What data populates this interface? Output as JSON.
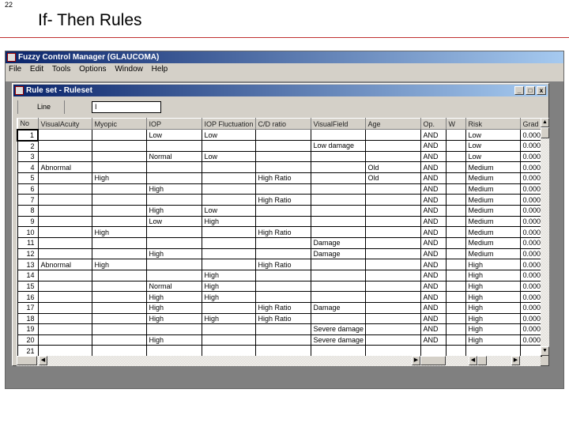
{
  "slide": {
    "number": "22",
    "title": "If- Then Rules"
  },
  "app": {
    "title": "Fuzzy Control Manager (GLAUCOMA)",
    "menu": [
      "File",
      "Edit",
      "Tools",
      "Options",
      "Window",
      "Help"
    ]
  },
  "child": {
    "title": "Rule set - Ruleset",
    "line_label": "Line",
    "line_value": "I",
    "buttons": {
      "minimize": "_",
      "maximize": "□",
      "close": "x"
    }
  },
  "grid": {
    "columns": [
      "No",
      "VisualAcuity",
      "Myopic",
      "IOP",
      "IOP Fluctuation",
      "C/D ratio",
      "VisualField",
      "Age",
      "Op.",
      "W",
      "Risk",
      "Grad"
    ],
    "rows": [
      [
        "1",
        "",
        "",
        "Low",
        "Low",
        "",
        "",
        "",
        "AND",
        "",
        "Low",
        "0.000"
      ],
      [
        "2",
        "",
        "",
        "",
        "",
        "",
        "Low damage",
        "",
        "AND",
        "",
        "Low",
        "0.000"
      ],
      [
        "3",
        "",
        "",
        "Normal",
        "Low",
        "",
        "",
        "",
        "AND",
        "",
        "Low",
        "0.000"
      ],
      [
        "4",
        "Abnormal",
        "",
        "",
        "",
        "",
        "",
        "Old",
        "AND",
        "",
        "Medium",
        "0.000"
      ],
      [
        "5",
        "",
        "High",
        "",
        "",
        "High Ratio",
        "",
        "Old",
        "AND",
        "",
        "Medium",
        "0.000"
      ],
      [
        "6",
        "",
        "",
        "High",
        "",
        "",
        "",
        "",
        "AND",
        "",
        "Medium",
        "0.000"
      ],
      [
        "7",
        "",
        "",
        "",
        "",
        "High Ratio",
        "",
        "",
        "AND",
        "",
        "Medium",
        "0.000"
      ],
      [
        "8",
        "",
        "",
        "High",
        "Low",
        "",
        "",
        "",
        "AND",
        "",
        "Medium",
        "0.000"
      ],
      [
        "9",
        "",
        "",
        "Low",
        "High",
        "",
        "",
        "",
        "AND",
        "",
        "Medium",
        "0.000"
      ],
      [
        "10",
        "",
        "High",
        "",
        "",
        "High Ratio",
        "",
        "",
        "AND",
        "",
        "Medium",
        "0.000"
      ],
      [
        "11",
        "",
        "",
        "",
        "",
        "",
        "Damage",
        "",
        "AND",
        "",
        "Medium",
        "0.000"
      ],
      [
        "12",
        "",
        "",
        "High",
        "",
        "",
        "Damage",
        "",
        "AND",
        "",
        "Medium",
        "0.000"
      ],
      [
        "13",
        "Abnormal",
        "High",
        "",
        "",
        "High Ratio",
        "",
        "",
        "AND",
        "",
        "High",
        "0.000"
      ],
      [
        "14",
        "",
        "",
        "",
        "High",
        "",
        "",
        "",
        "AND",
        "",
        "High",
        "0.000"
      ],
      [
        "15",
        "",
        "",
        "Normal",
        "High",
        "",
        "",
        "",
        "AND",
        "",
        "High",
        "0.000"
      ],
      [
        "16",
        "",
        "",
        "High",
        "High",
        "",
        "",
        "",
        "AND",
        "",
        "High",
        "0.000"
      ],
      [
        "17",
        "",
        "",
        "High",
        "",
        "High Ratio",
        "Damage",
        "",
        "AND",
        "",
        "High",
        "0.000"
      ],
      [
        "18",
        "",
        "",
        "High",
        "High",
        "High Ratio",
        "",
        "",
        "AND",
        "",
        "High",
        "0.000"
      ],
      [
        "19",
        "",
        "",
        "",
        "",
        "",
        "Severe damage",
        "",
        "AND",
        "",
        "High",
        "0.000"
      ],
      [
        "20",
        "",
        "",
        "High",
        "",
        "",
        "Severe damage",
        "",
        "AND",
        "",
        "High",
        "0.000"
      ],
      [
        "21",
        "",
        "",
        "",
        "",
        "",
        "",
        "",
        "",
        "",
        "",
        ""
      ]
    ]
  }
}
